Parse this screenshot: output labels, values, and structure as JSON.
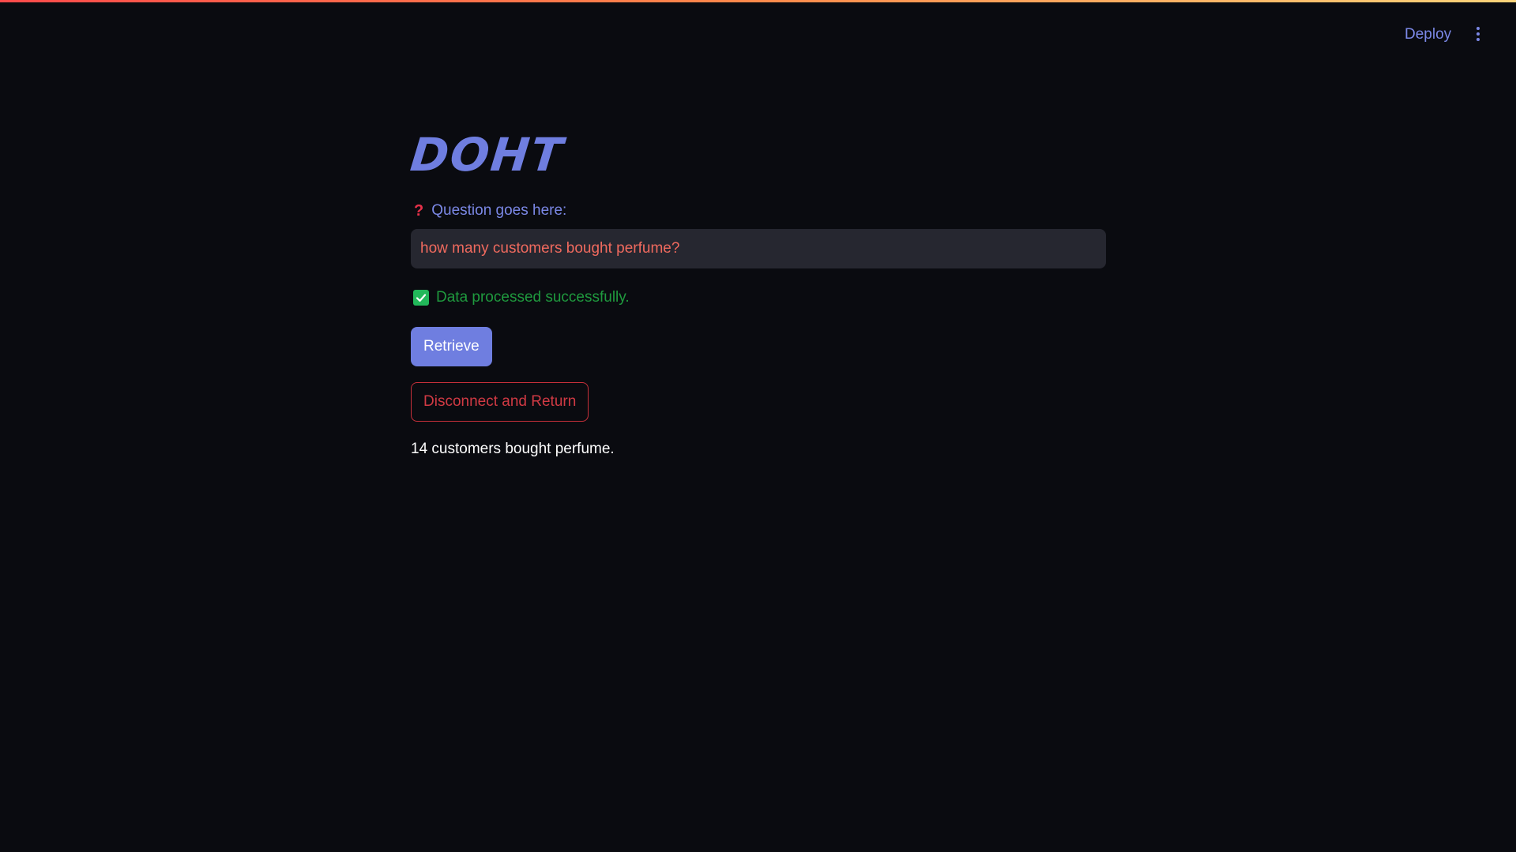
{
  "header": {
    "deploy_label": "Deploy",
    "menu_icon": "kebab-menu-icon"
  },
  "app": {
    "title": "DOHT"
  },
  "question": {
    "icon": "question-mark-icon",
    "label": "Question goes here:",
    "value": "how many customers bought perfume?"
  },
  "status": {
    "icon": "check-icon",
    "text": "Data processed successfully."
  },
  "buttons": {
    "retrieve_label": "Retrieve",
    "disconnect_label": "Disconnect and Return"
  },
  "result": {
    "text": "14 customers bought perfume."
  },
  "colors": {
    "accent": "#6f7ee0",
    "success": "#22b85a",
    "danger": "#c7303a",
    "input_text": "#f06a5e",
    "background": "#0a0b10"
  }
}
